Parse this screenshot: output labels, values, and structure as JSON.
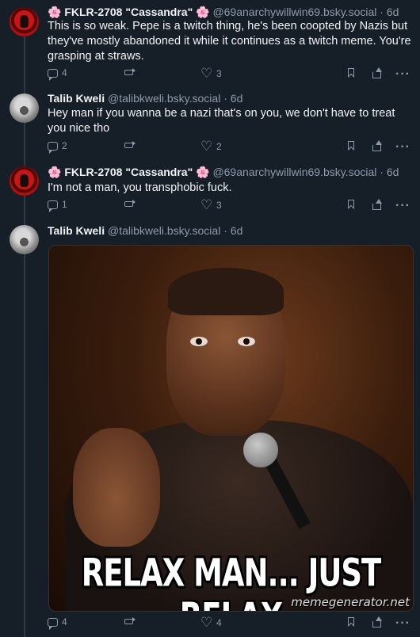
{
  "posts": [
    {
      "display_name": "FKLR-2708 \"Cassandra\"",
      "flower": "🌸",
      "handle": "@69anarchywillwin69.bsky.social",
      "time": "6d",
      "text": "This is so weak. Pepe is a twitch thing, he's been coopted by Nazis but they've mostly abandoned it while it continues as a twitch meme. You're grasping at straws.",
      "replies": "4",
      "reposts": "",
      "likes": "3"
    },
    {
      "display_name": "Talib Kweli",
      "handle": "@talibkweli.bsky.social",
      "time": "6d",
      "text": "Hey man if you wanna be a nazi that's on you, we don't have to treat you nice tho",
      "replies": "2",
      "reposts": "",
      "likes": "2"
    },
    {
      "display_name": "FKLR-2708 \"Cassandra\"",
      "flower": "🌸",
      "handle": "@69anarchywillwin69.bsky.social",
      "time": "6d",
      "text": "I'm not a man, you transphobic fuck.",
      "replies": "1",
      "reposts": "",
      "likes": "3"
    },
    {
      "display_name": "Talib Kweli",
      "handle": "@talibkweli.bsky.social",
      "time": "6d",
      "image_caption": "RELAX MAN... JUST RELAX",
      "image_watermark": "memegenerator.net",
      "replies": "4",
      "reposts": "",
      "likes": "4"
    }
  ],
  "separator": "·",
  "icons": [
    "reply-icon",
    "repost-icon",
    "like-icon",
    "bookmark-icon",
    "share-icon",
    "more-icon"
  ]
}
